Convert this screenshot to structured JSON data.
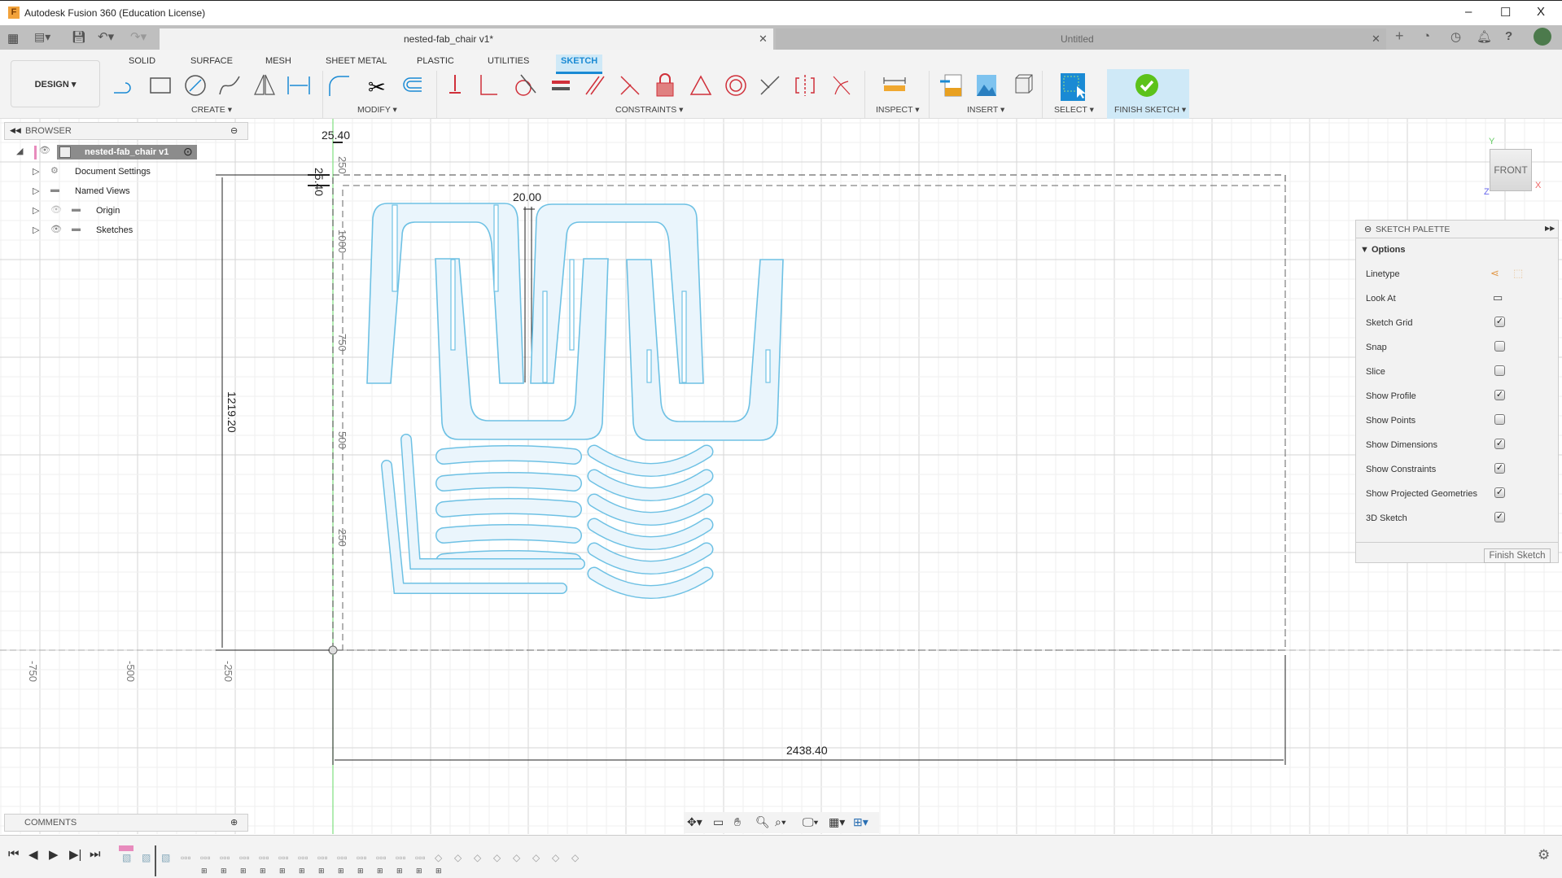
{
  "app": {
    "title": "Autodesk Fusion 360 (Education License)",
    "logo_letter": "F"
  },
  "window_controls": {
    "minimize": "–",
    "maximize": "☐",
    "close": "X"
  },
  "document_tabs": [
    {
      "label": "nested-fab_chair v1*",
      "active": true
    },
    {
      "label": "Untitled",
      "active": false
    }
  ],
  "workspace_tabs": [
    "SOLID",
    "SURFACE",
    "MESH",
    "SHEET METAL",
    "PLASTIC",
    "UTILITIES",
    "SKETCH"
  ],
  "active_workspace_tab": "SKETCH",
  "design_button": "DESIGN ▾",
  "tool_groups": {
    "create": "CREATE ▾",
    "modify": "MODIFY ▾",
    "constraints": "CONSTRAINTS ▾",
    "inspect": "INSPECT ▾",
    "insert": "INSERT ▾",
    "select": "SELECT ▾",
    "finish": "FINISH SKETCH ▾"
  },
  "tools": [
    "line",
    "rectangle",
    "circle",
    "spline",
    "mirror",
    "dimension",
    "fillet",
    "trim",
    "offset",
    "fix",
    "coincident",
    "tangent",
    "equal",
    "parallel",
    "perpendicular",
    "lock",
    "triangle",
    "concentric",
    "midpoint",
    "symmetry",
    "curvature",
    "measure",
    "insert-svg",
    "insert-image",
    "insert-mesh",
    "select",
    "finish-sketch"
  ],
  "browser": {
    "title": "BROWSER",
    "root": "nested-fab_chair v1",
    "items": [
      {
        "label": "Document Settings",
        "icon": "gear-icon"
      },
      {
        "label": "Named Views",
        "icon": "folder-icon"
      },
      {
        "label": "Origin",
        "icon": "folder-icon",
        "hidden": true
      },
      {
        "label": "Sketches",
        "icon": "folder-icon"
      }
    ]
  },
  "comments": {
    "title": "COMMENTS"
  },
  "sketch_palette": {
    "title": "SKETCH PALETTE",
    "section": "Options",
    "linetype": "Linetype",
    "look_at": "Look At",
    "options": [
      {
        "label": "Sketch Grid",
        "checked": true
      },
      {
        "label": "Snap",
        "checked": false
      },
      {
        "label": "Slice",
        "checked": false
      },
      {
        "label": "Show Profile",
        "checked": true
      },
      {
        "label": "Show Points",
        "checked": false
      },
      {
        "label": "Show Dimensions",
        "checked": true
      },
      {
        "label": "Show Constraints",
        "checked": true
      },
      {
        "label": "Show Projected Geometries",
        "checked": true
      },
      {
        "label": "3D Sketch",
        "checked": true
      }
    ],
    "finish_button": "Finish Sketch"
  },
  "viewcube": {
    "face": "FRONT",
    "axis_y": "Y",
    "axis_x": "X",
    "axis_z": "Z"
  },
  "dimensions": {
    "width": "2438.40",
    "height": "1219.20",
    "top_offset": "25.40",
    "left_offset": "25.40",
    "gap": "20.00"
  },
  "axis_labels": {
    "x": [
      "-750",
      "-500",
      "-250"
    ],
    "y": [
      "1000",
      "750",
      "500",
      "250"
    ],
    "top_partial": "250"
  },
  "colors": {
    "sketch_stroke": "#6ec1e4",
    "sketch_fill": "#eaf5fc",
    "accent": "#1a8ad4",
    "axis_green": "#7ee07e",
    "finish_green": "#5cc21a"
  }
}
